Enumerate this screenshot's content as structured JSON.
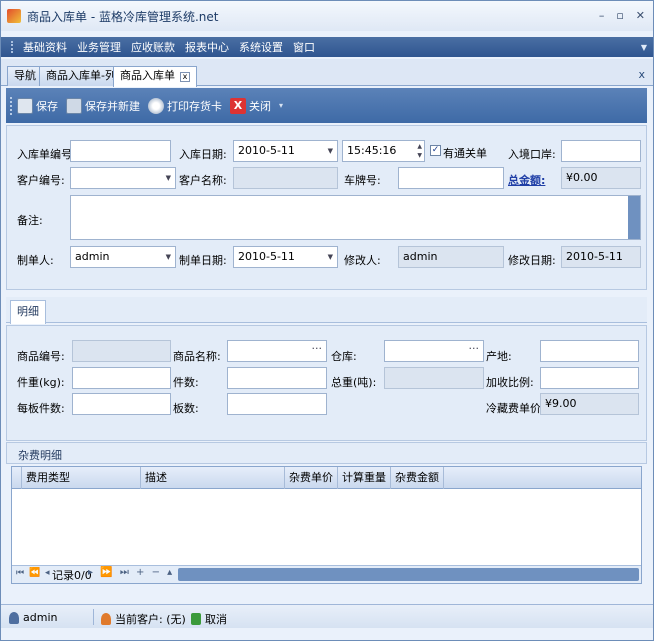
{
  "window": {
    "title": "商品入库单 - 蓝格冷库管理系统.net",
    "controls": [
      "–",
      "▫",
      "✕"
    ]
  },
  "menu": {
    "items": [
      "基础资料",
      "业务管理",
      "应收账款",
      "报表中心",
      "系统设置",
      "窗口"
    ]
  },
  "tabs": [
    {
      "label": "导航",
      "active": false
    },
    {
      "label": "商品入库单-列表",
      "active": false
    },
    {
      "label": "商品入库单",
      "active": true
    }
  ],
  "tab_close_glyph": "x",
  "toolbar": {
    "save": "保存",
    "save_new": "保存并新建",
    "print": "打印存货卡",
    "close": "关闭"
  },
  "header_form": {
    "receipt_no_label": "入库单编号:",
    "receipt_no": "",
    "date_label": "入库日期:",
    "date": "2010-5-11",
    "time": "15:45:16",
    "customs_label": "有通关单",
    "customs_checked": true,
    "port_label": "入境口岸:",
    "port": "",
    "customer_no_label": "客户编号:",
    "customer_no": "",
    "customer_name_label": "客户名称:",
    "customer_name": "",
    "plate_label": "车牌号:",
    "plate": "",
    "total_label": "总金额:",
    "total": "¥0.00",
    "remark_label": "备注:",
    "remark": "",
    "maker_label": "制单人:",
    "maker": "admin",
    "make_date_label": "制单日期:",
    "make_date": "2010-5-11",
    "modifier_label": "修改人:",
    "modifier": "admin",
    "modify_date_label": "修改日期:",
    "modify_date": "2010-5-11"
  },
  "detail_tab": "明细",
  "detail_form": {
    "product_no_label": "商品编号:",
    "product_no": "",
    "product_name_label": "商品名称:",
    "product_name": "",
    "warehouse_label": "仓库:",
    "warehouse": "",
    "origin_label": "产地:",
    "origin": "",
    "unit_weight_label": "件重(kg):",
    "unit_weight": "",
    "pieces_label": "件数:",
    "pieces": "",
    "total_weight_label": "总重(吨):",
    "total_weight": "",
    "ratio_label": "加收比例:",
    "ratio": "",
    "per_pallet_label": "每板件数:",
    "per_pallet": "",
    "pallets_label": "板数:",
    "pallets": "",
    "storage_price_label": "冷藏费单价:",
    "storage_price": "¥9.00"
  },
  "misc_section": "杂费明细",
  "misc_grid": {
    "columns": [
      "费用类型",
      "描述",
      "杂费单价",
      "计算重量",
      "杂费金额"
    ],
    "rows": [],
    "nav_first": "⏮ ⏪ ◂",
    "record_text": "记录0/0",
    "nav_rest": "▸ ⏩ ⏭ + − ▴ ✓ ✕"
  },
  "status": {
    "user": "admin",
    "current_customer_label": "当前客户:",
    "current_customer": "(无)",
    "cancel": "取消"
  }
}
